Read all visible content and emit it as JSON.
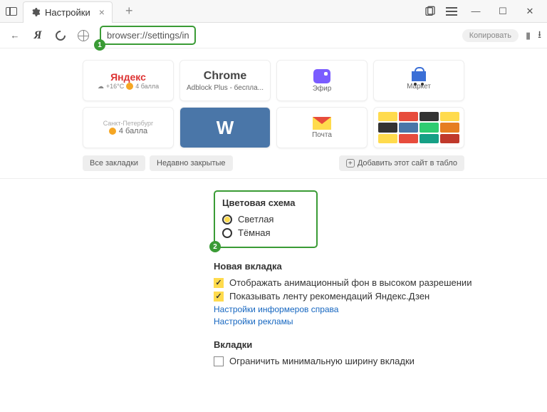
{
  "titlebar": {
    "tab_title": "Настройки",
    "close_glyph": "×",
    "new_tab_glyph": "+"
  },
  "toolbar": {
    "url": "browser://settings/interface",
    "copy_label": "Копировать"
  },
  "tiles": {
    "yandex": {
      "logo": "Яндекс",
      "temp": "+16°C",
      "score": "4 балла"
    },
    "chrome": {
      "logo": "Chrome",
      "sub": "Adblock Plus - беспла..."
    },
    "efir": {
      "label": "Эфир"
    },
    "market": {
      "label": "Маркет"
    },
    "spb": {
      "city": "Санкт-Петербург",
      "score": "4 балла"
    },
    "mail": {
      "label": "Почта"
    }
  },
  "tiles_footer": {
    "all_bookmarks": "Все закладки",
    "recently_closed": "Недавно закрытые",
    "add_site": "Добавить этот сайт в табло"
  },
  "settings": {
    "color_scheme": {
      "title": "Цветовая схема",
      "light": "Светлая",
      "dark": "Тёмная"
    },
    "new_tab": {
      "title": "Новая вкладка",
      "animated_bg": "Отображать анимационный фон в высоком разрешении",
      "zen_feed": "Показывать ленту рекомендаций Яндекс.Дзен",
      "informers_link": "Настройки информеров справа",
      "ads_link": "Настройки рекламы"
    },
    "tabs": {
      "title": "Вкладки",
      "min_width": "Ограничить минимальную ширину вкладки"
    }
  },
  "annotations": {
    "one": "1",
    "two": "2"
  }
}
